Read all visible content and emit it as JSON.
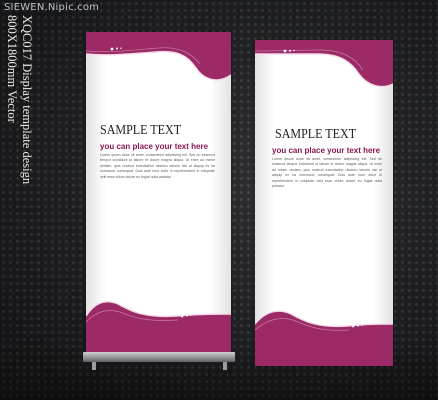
{
  "watermark": "SIEWEN.Nipic.com",
  "side_caption": {
    "line1": "XQC017 Display template design",
    "line2": "800X1800mm Vector"
  },
  "banners": [
    {
      "title": "SAMPLE TEXT",
      "subtitle": "you can place your text here",
      "body": "Lorem ipsum dolor sit amet, consectetur adipiscing elit. Sed do eiusmod tempor incididunt ut labore et dolore magna aliqua. Ut enim ad minim veniam, quis nostrud exercitation ullamco laboris nisi ut aliquip ex ea commodo consequat. Duis aute irure dolor in reprehenderit in voluptate velit esse cillum dolore eu fugiat nulla pariatur.",
      "accent_color": "#9b2a66"
    },
    {
      "title": "SAMPLE TEXT",
      "subtitle": "you can place your text here",
      "body": "Lorem ipsum dolor sit amet, consectetur adipiscing elit. Sed do eiusmod tempor incididunt ut labore et dolore magna aliqua. Ut enim ad minim veniam, quis nostrud exercitation ullamco laboris nisi ut aliquip ex ea commodo consequat. Duis aute irure dolor in reprehenderit in voluptate velit esse cillum dolore eu fugiat nulla pariatur.",
      "accent_color": "#9b2a66"
    }
  ],
  "background_color": "#202123"
}
